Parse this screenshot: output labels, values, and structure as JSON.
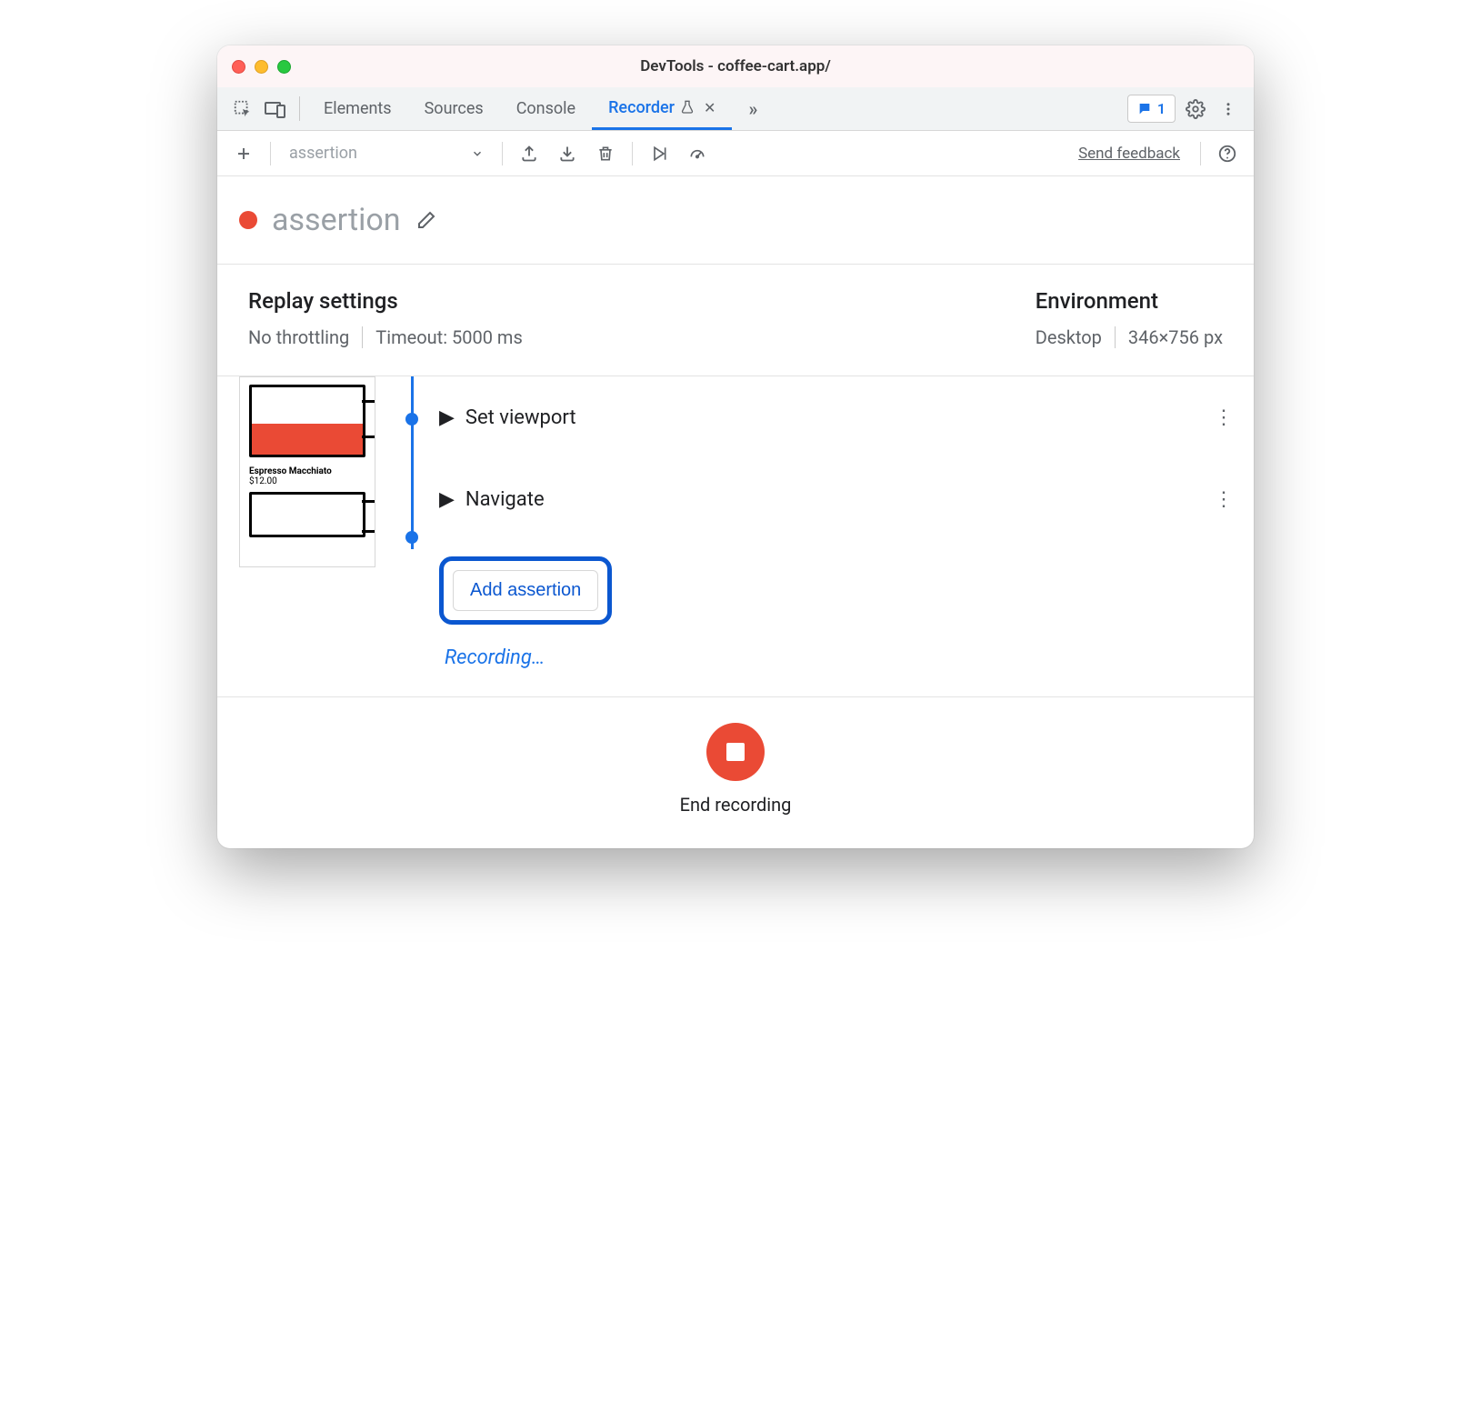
{
  "window": {
    "title": "DevTools - coffee-cart.app/"
  },
  "tabs": {
    "items": [
      "Elements",
      "Sources",
      "Console",
      "Recorder"
    ],
    "active": "Recorder",
    "badge_count": "1"
  },
  "toolbar": {
    "recording_selector": "assertion",
    "send_feedback": "Send feedback"
  },
  "recording": {
    "title": "assertion"
  },
  "replay_settings": {
    "heading": "Replay settings",
    "throttling": "No throttling",
    "timeout": "Timeout: 5000 ms"
  },
  "environment": {
    "heading": "Environment",
    "device": "Desktop",
    "viewport": "346×756 px"
  },
  "thumbnail": {
    "product": "Espresso Macchiato",
    "price": "$12.00"
  },
  "steps": [
    {
      "label": "Set viewport"
    },
    {
      "label": "Navigate"
    }
  ],
  "actions": {
    "add_assertion": "Add assertion",
    "recording_status": "Recording…",
    "end_recording": "End recording"
  }
}
